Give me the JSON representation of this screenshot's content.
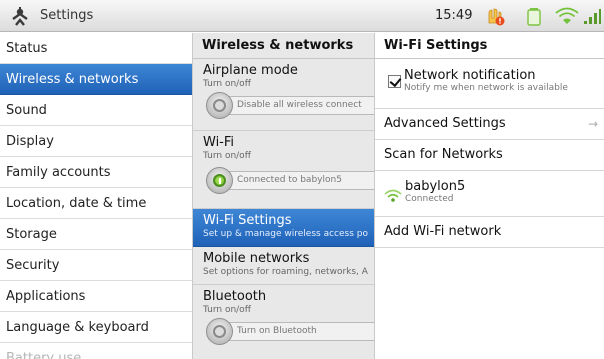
{
  "status_bar": {
    "app_title": "Settings",
    "time": "15:49",
    "icons": [
      "settings-app-icon",
      "warning-icon",
      "battery-icon",
      "wifi-icon",
      "signal-icon"
    ],
    "colors": {
      "warning": "#f39a1b",
      "battery": "#7ec242",
      "wifi": "#74c23a",
      "signal": "#5a9a2a"
    }
  },
  "left_menu": {
    "selected_color": "#2a72c8",
    "items": [
      {
        "label": "Status"
      },
      {
        "label": "Wireless & networks"
      },
      {
        "label": "Sound"
      },
      {
        "label": "Display"
      },
      {
        "label": "Family accounts"
      },
      {
        "label": "Location, date & time"
      },
      {
        "label": "Storage"
      },
      {
        "label": "Security"
      },
      {
        "label": "Applications"
      },
      {
        "label": "Language & keyboard"
      },
      {
        "label": "Battery use"
      }
    ]
  },
  "wireless": {
    "header": "Wireless & networks",
    "airplane": {
      "title": "Airplane mode",
      "subtitle": "Turn on/off",
      "toggle_text": "Disable all wireless connect"
    },
    "wifi": {
      "title": "Wi-Fi",
      "subtitle": "Turn on/off",
      "toggle_text": "Connected to babylon5"
    },
    "wifi_settings": {
      "title": "Wi-Fi Settings",
      "subtitle": "Set up & manage wireless access po"
    },
    "mobile": {
      "title": "Mobile networks",
      "subtitle": "Set options for roaming, networks, A"
    },
    "bluetooth": {
      "title": "Bluetooth",
      "subtitle": "Turn on/off",
      "toggle_text": "Turn on Bluetooth"
    }
  },
  "wifi_settings_panel": {
    "header": "Wi-Fi Settings",
    "network_notification": {
      "title": "Network notification",
      "subtitle": "Notify me when network is available",
      "checked": true
    },
    "advanced": {
      "label": "Advanced Settings",
      "arrow": "→"
    },
    "scan": {
      "label": "Scan for Networks"
    },
    "network": {
      "name": "babylon5",
      "status": "Connected"
    },
    "add": {
      "label": "Add Wi-Fi network"
    }
  }
}
